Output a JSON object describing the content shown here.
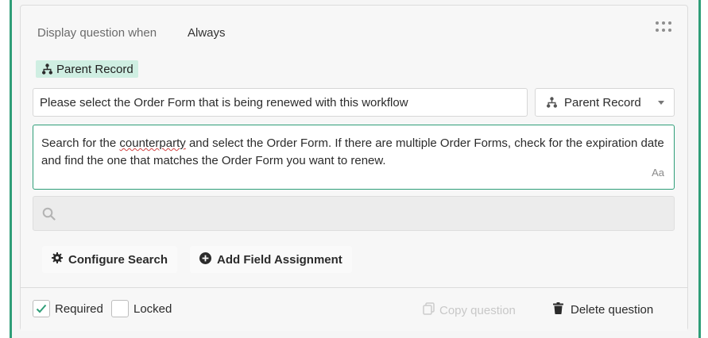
{
  "condition": {
    "label": "Display question when",
    "value": "Always"
  },
  "tag": {
    "label": "Parent Record",
    "icon": "tree-icon"
  },
  "question": {
    "value": "Please select the Order Form that is being renewed with this workflow"
  },
  "type_select": {
    "label": "Parent Record",
    "icon": "tree-icon"
  },
  "description": {
    "text_before": "Search for the ",
    "misspelled": "counterparty",
    "text_after": " and select the Order Form. If there are multiple Order Forms, check for the expiration date and find the one that matches the Order Form you want to renew.",
    "format_label": "Aa"
  },
  "search": {
    "placeholder": "",
    "icon": "search-icon"
  },
  "actions": {
    "configure_label": "Configure Search",
    "add_field_label": "Add Field Assignment"
  },
  "footer": {
    "required_label": "Required",
    "required_checked": true,
    "locked_label": "Locked",
    "locked_checked": false,
    "copy_label": "Copy question",
    "delete_label": "Delete question"
  },
  "colors": {
    "accent": "#2f9e78",
    "tag_bg": "#cfeee2"
  }
}
